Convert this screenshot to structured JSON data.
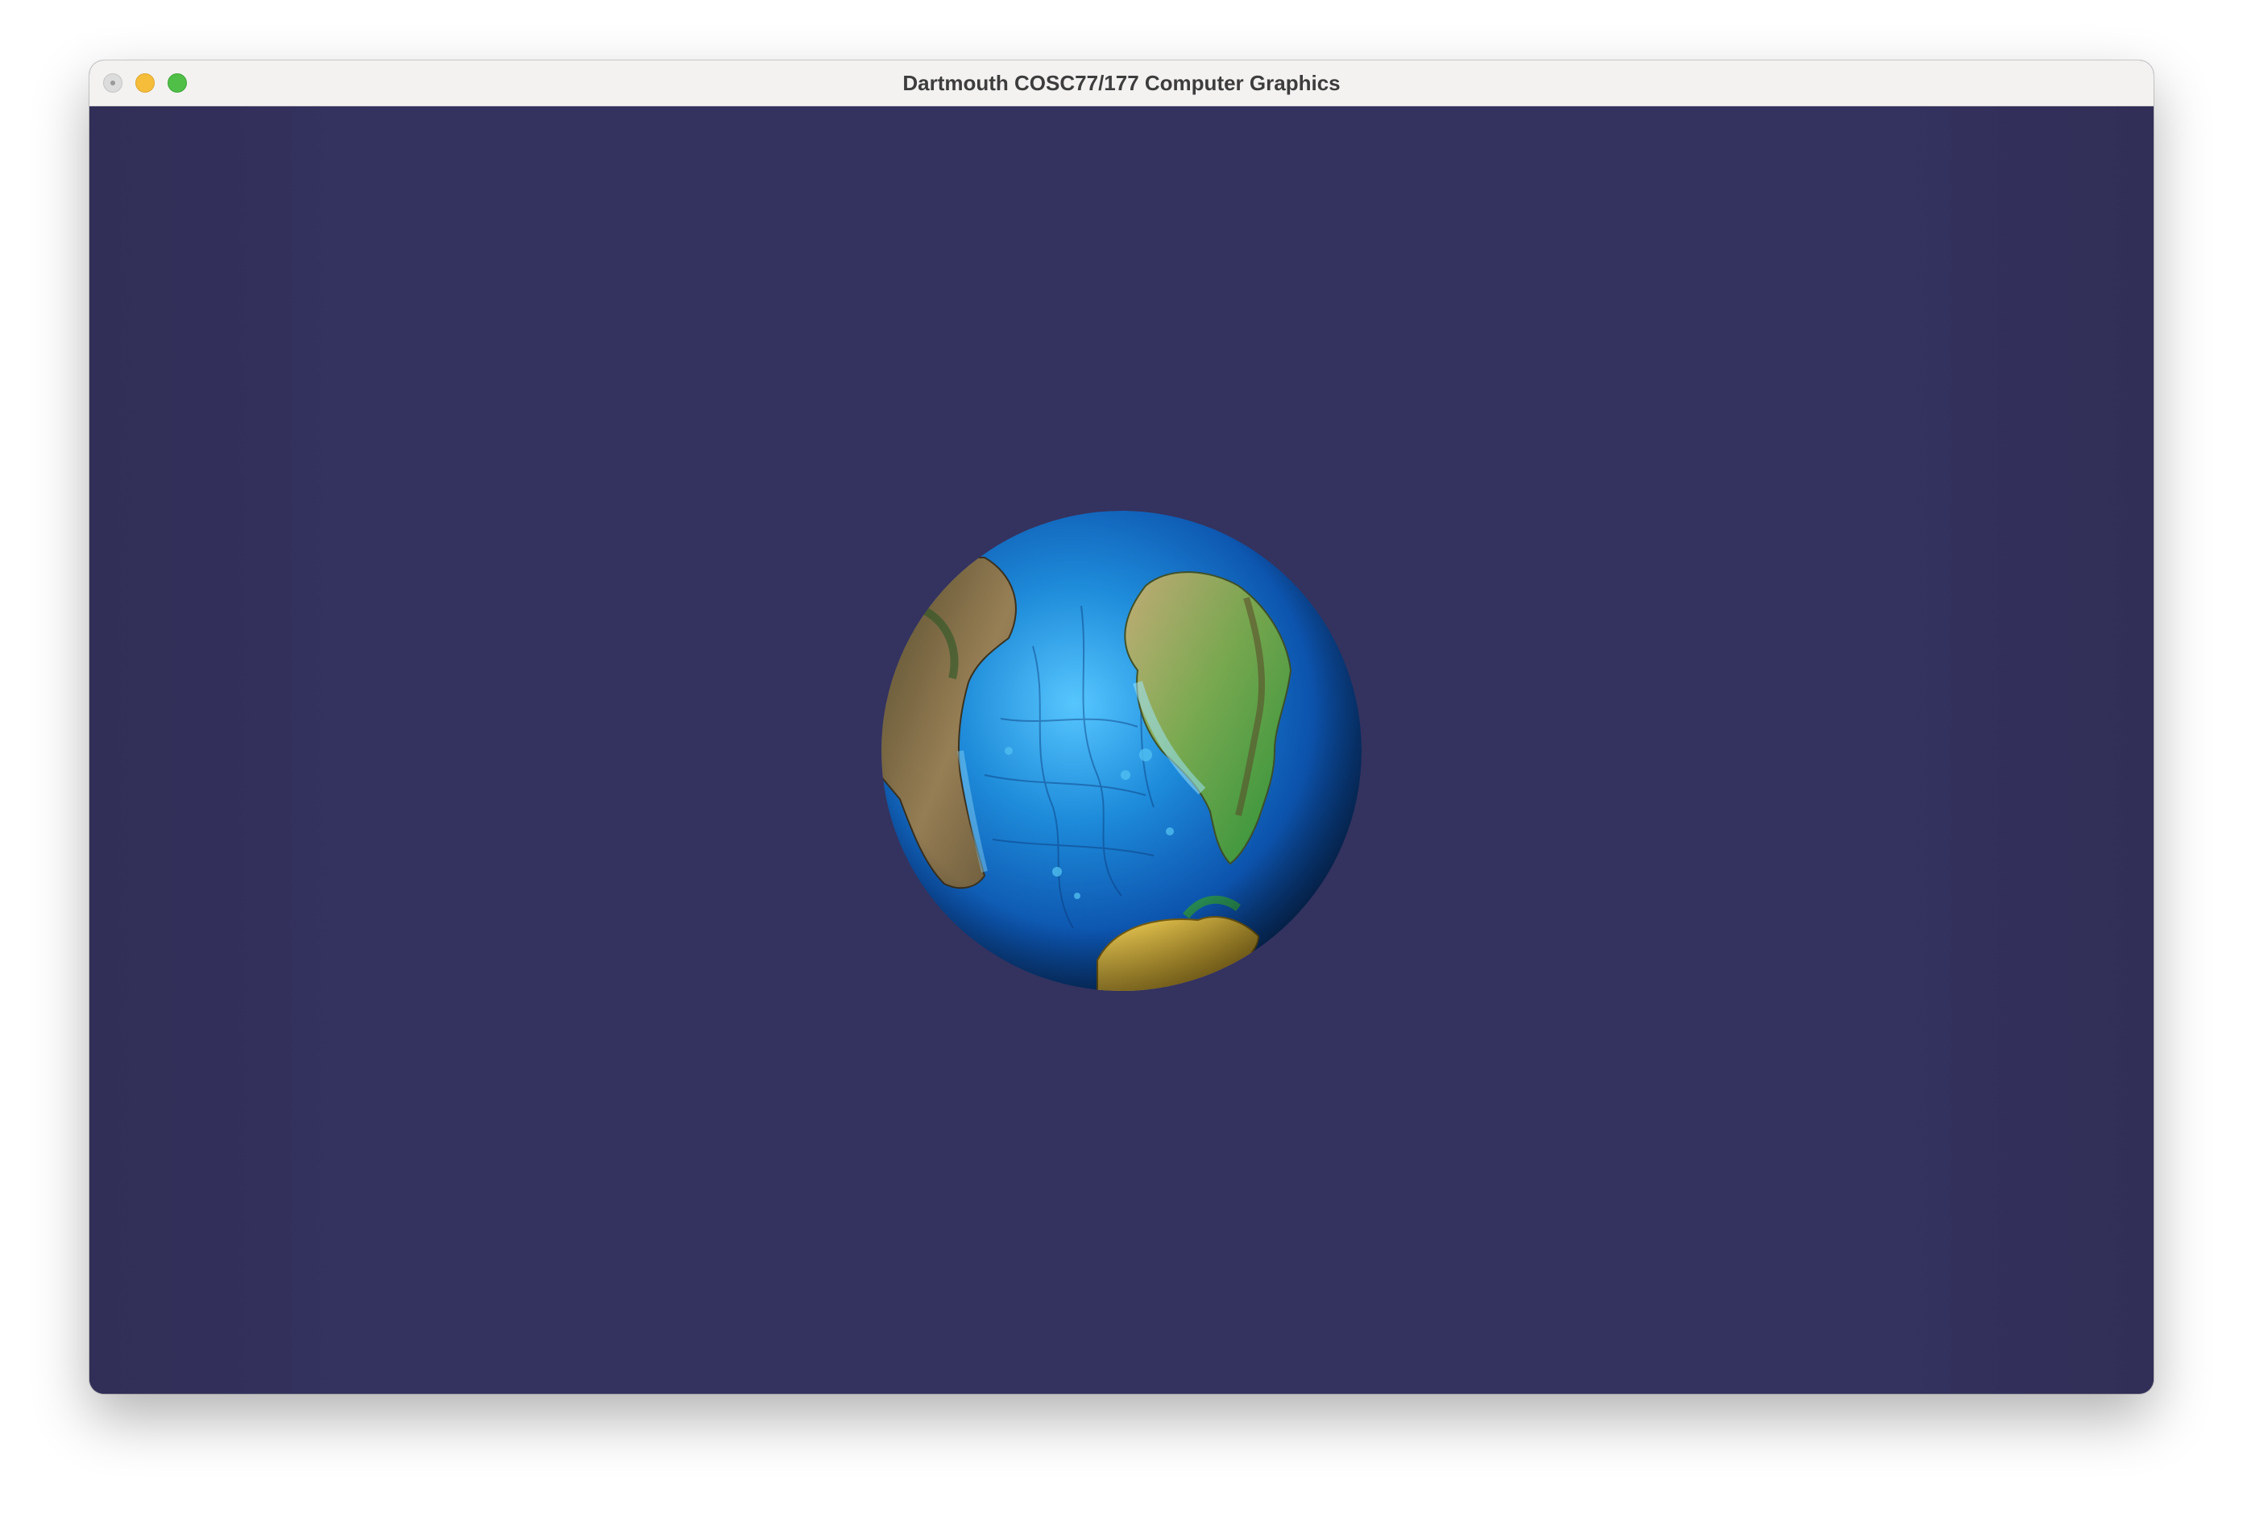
{
  "window": {
    "title": "Dartmouth COSC77/177 Computer Graphics",
    "controls": [
      "close",
      "minimize",
      "zoom"
    ]
  },
  "viewport": {
    "background_color": "#34325f",
    "content": "earth-globe",
    "continents_visible": [
      "South America",
      "Africa",
      "Antarctica"
    ],
    "colors": {
      "ocean_deep": "#0a3f95",
      "ocean_light": "#2aa3e8",
      "land_green": "#2f9a3c",
      "land_tan": "#b89a63",
      "ice": "#d7b23a"
    }
  }
}
